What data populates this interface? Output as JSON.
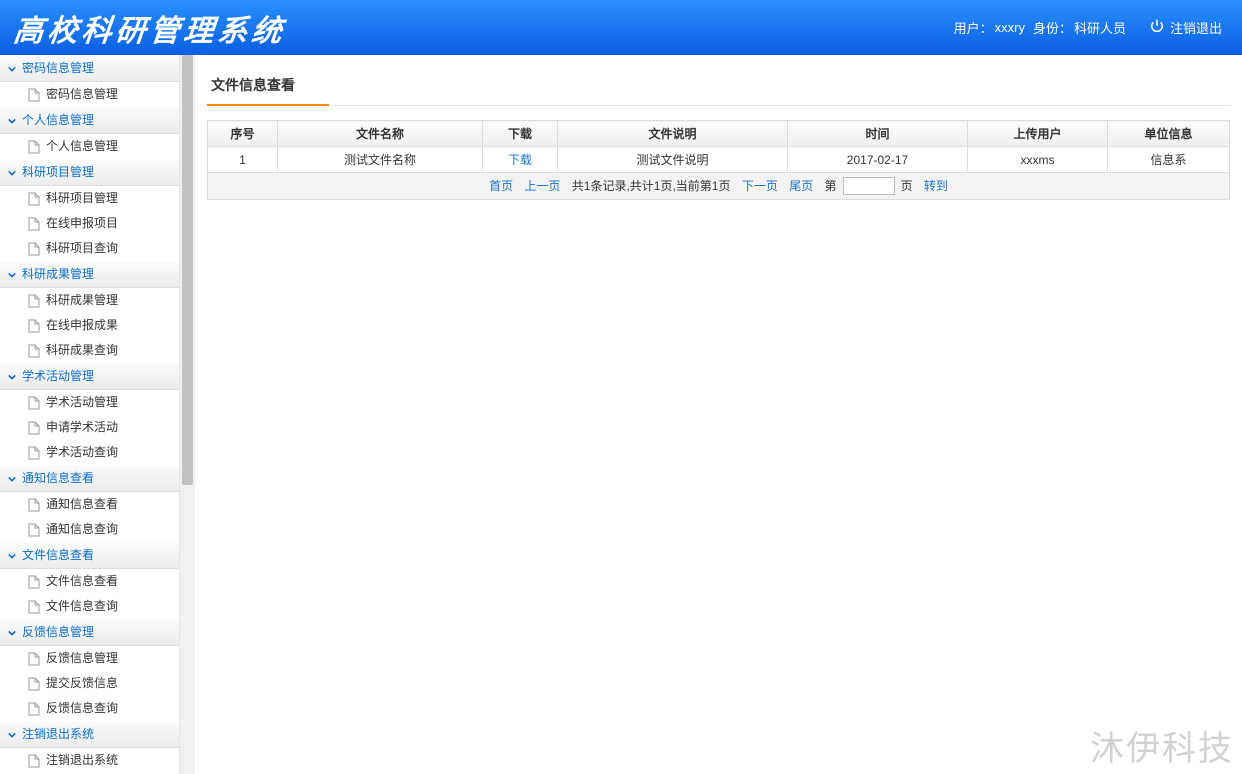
{
  "header": {
    "app_title": "高校科研管理系统",
    "user_label": "用户：",
    "user_name": "xxxry",
    "role_label": "身份：",
    "role_name": "科研人员",
    "logout": "注销退出"
  },
  "sidebar": [
    {
      "title": "密码信息管理",
      "items": [
        "密码信息管理"
      ]
    },
    {
      "title": "个人信息管理",
      "items": [
        "个人信息管理"
      ]
    },
    {
      "title": "科研项目管理",
      "items": [
        "科研项目管理",
        "在线申报项目",
        "科研项目查询"
      ]
    },
    {
      "title": "科研成果管理",
      "items": [
        "科研成果管理",
        "在线申报成果",
        "科研成果查询"
      ]
    },
    {
      "title": "学术活动管理",
      "items": [
        "学术活动管理",
        "申请学术活动",
        "学术活动查询"
      ]
    },
    {
      "title": "通知信息查看",
      "items": [
        "通知信息查看",
        "通知信息查询"
      ]
    },
    {
      "title": "文件信息查看",
      "items": [
        "文件信息查看",
        "文件信息查询"
      ]
    },
    {
      "title": "反馈信息管理",
      "items": [
        "反馈信息管理",
        "提交反馈信息",
        "反馈信息查询"
      ]
    },
    {
      "title": "注销退出系统",
      "items": [
        "注销退出系统"
      ]
    }
  ],
  "page": {
    "title": "文件信息查看"
  },
  "table": {
    "headers": [
      "序号",
      "文件名称",
      "下载",
      "文件说明",
      "时间",
      "上传用户",
      "单位信息"
    ],
    "rows": [
      {
        "seq": "1",
        "name": "测试文件名称",
        "download": "下载",
        "desc": "测试文件说明",
        "time": "2017-02-17",
        "uploader": "xxxms",
        "unit": "信息系"
      }
    ]
  },
  "pager": {
    "first": "首页",
    "prev": "上一页",
    "info": "共1条记录,共计1页,当前第1页",
    "next": "下一页",
    "last": "尾页",
    "jump_prefix": "第",
    "jump_suffix": "页",
    "go": "转到",
    "input_value": ""
  },
  "watermark": "沐伊科技"
}
